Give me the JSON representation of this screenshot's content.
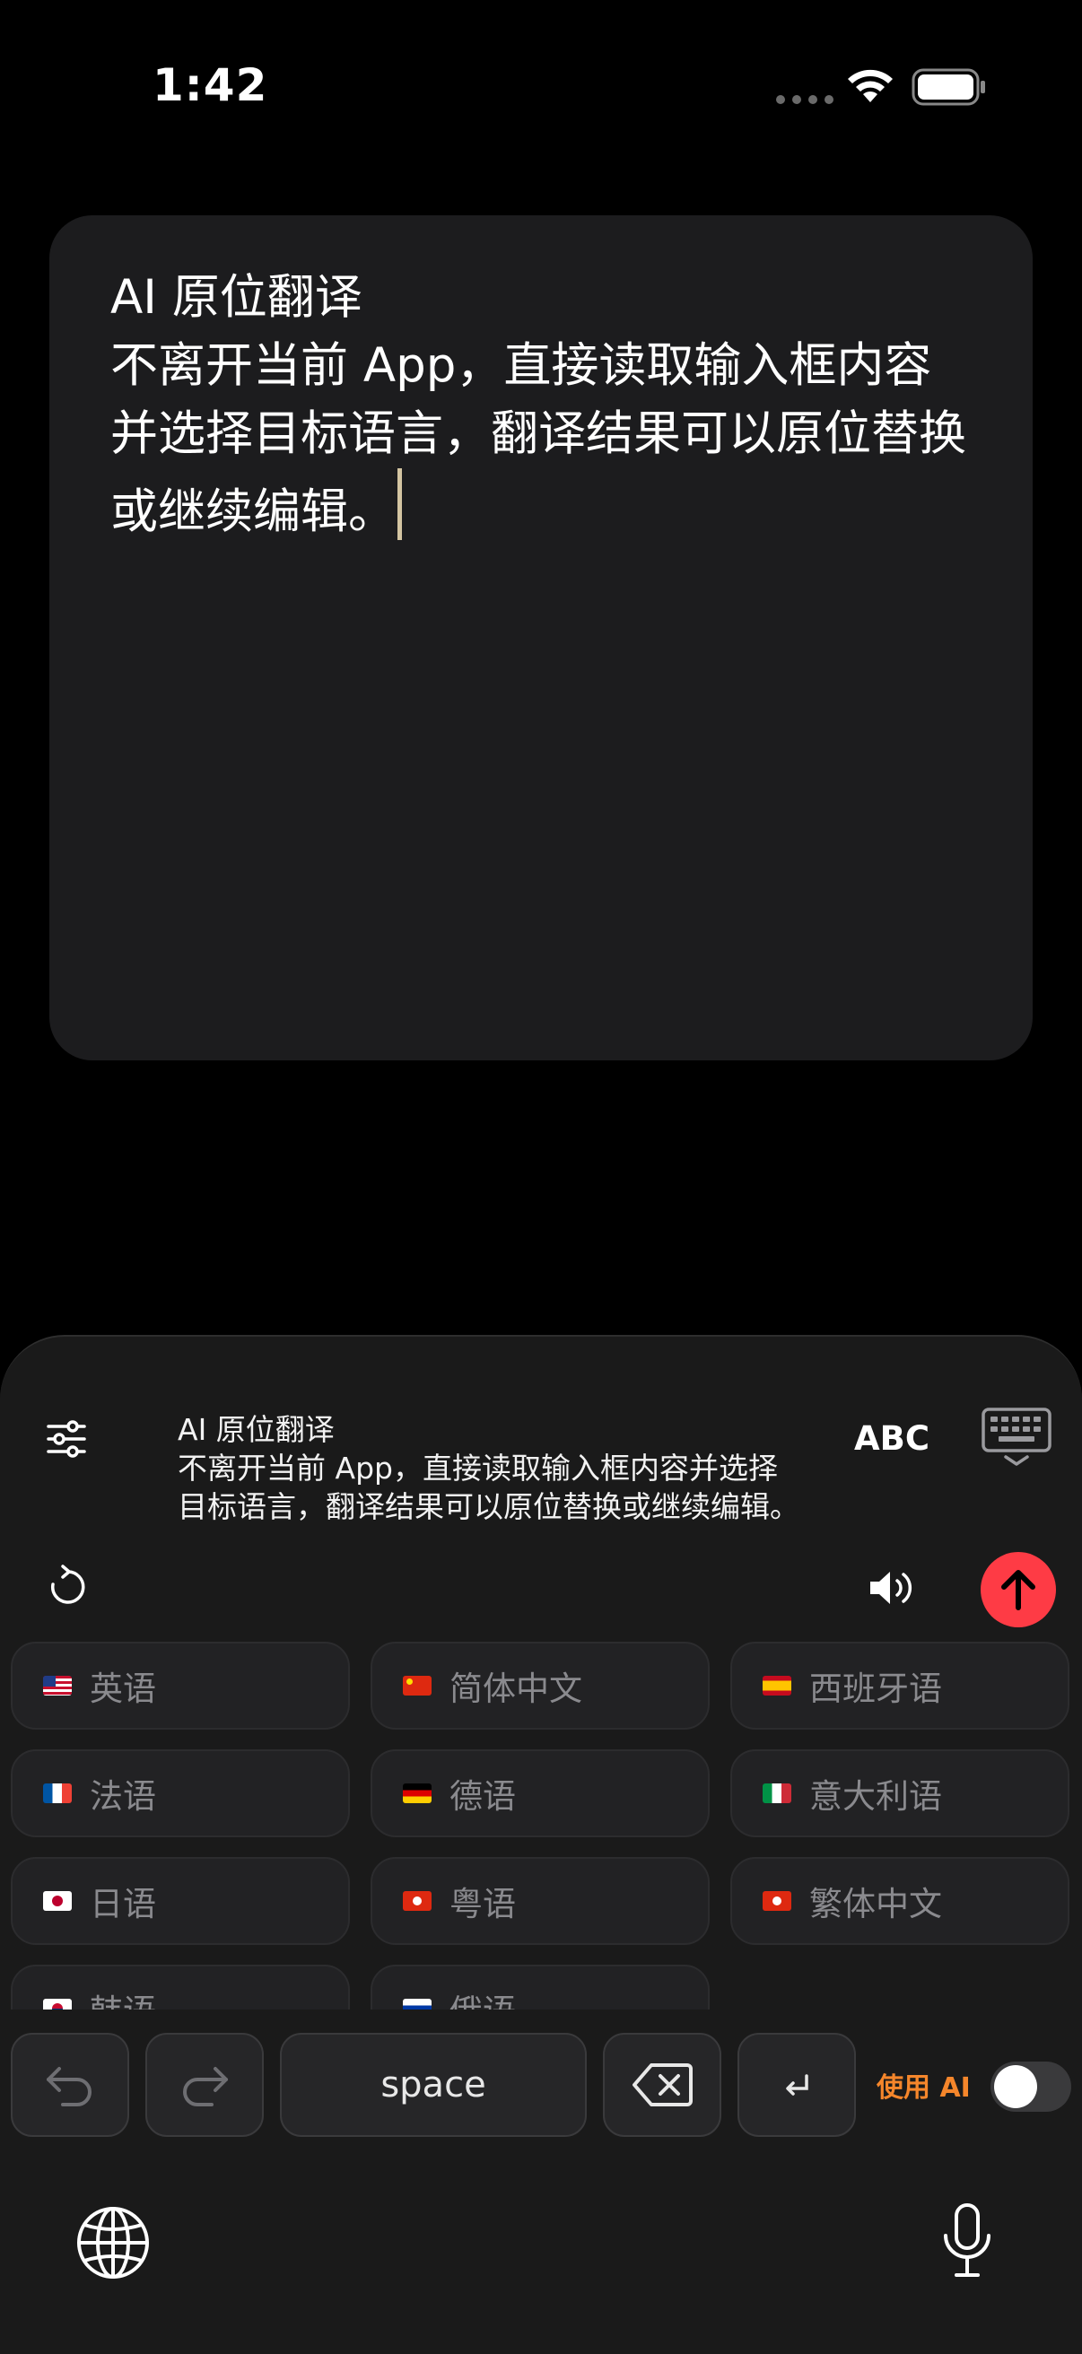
{
  "status_bar": {
    "time": "1:42"
  },
  "editor": {
    "text": "AI 原位翻译\n不离开当前 App，直接读取输入框内容并选择目标语言，翻译结果可以原位替换或继续编辑。"
  },
  "keyboard": {
    "preview_text": "AI 原位翻译\n不离开当前 App，直接读取输入框内容并选择目标语言，翻译结果可以原位替换或继续编辑。",
    "abc_label": "ABC",
    "languages": [
      {
        "label": "英语",
        "flag": "us"
      },
      {
        "label": "简体中文",
        "flag": "cn"
      },
      {
        "label": "西班牙语",
        "flag": "es"
      },
      {
        "label": "法语",
        "flag": "fr"
      },
      {
        "label": "德语",
        "flag": "de"
      },
      {
        "label": "意大利语",
        "flag": "it"
      },
      {
        "label": "日语",
        "flag": "jp"
      },
      {
        "label": "粤语",
        "flag": "hk"
      },
      {
        "label": "繁体中文",
        "flag": "hk"
      },
      {
        "label": "韩语",
        "flag": "kr"
      },
      {
        "label": "俄语",
        "flag": "ru"
      }
    ],
    "space_label": "space",
    "use_ai_label": "使用 AI",
    "use_ai_enabled": false
  },
  "colors": {
    "accent_send": "#fe3b45",
    "accent_ai_label": "#f5862b"
  },
  "icons": {
    "settings": "sliders-icon",
    "refresh": "refresh-icon",
    "keyboard": "keyboard-dismiss-icon",
    "speaker": "speaker-icon",
    "send": "arrow-up-icon",
    "undo": "undo-icon",
    "redo": "redo-icon",
    "delete": "backspace-icon",
    "return": "return-icon",
    "globe": "globe-icon",
    "mic": "microphone-icon"
  }
}
